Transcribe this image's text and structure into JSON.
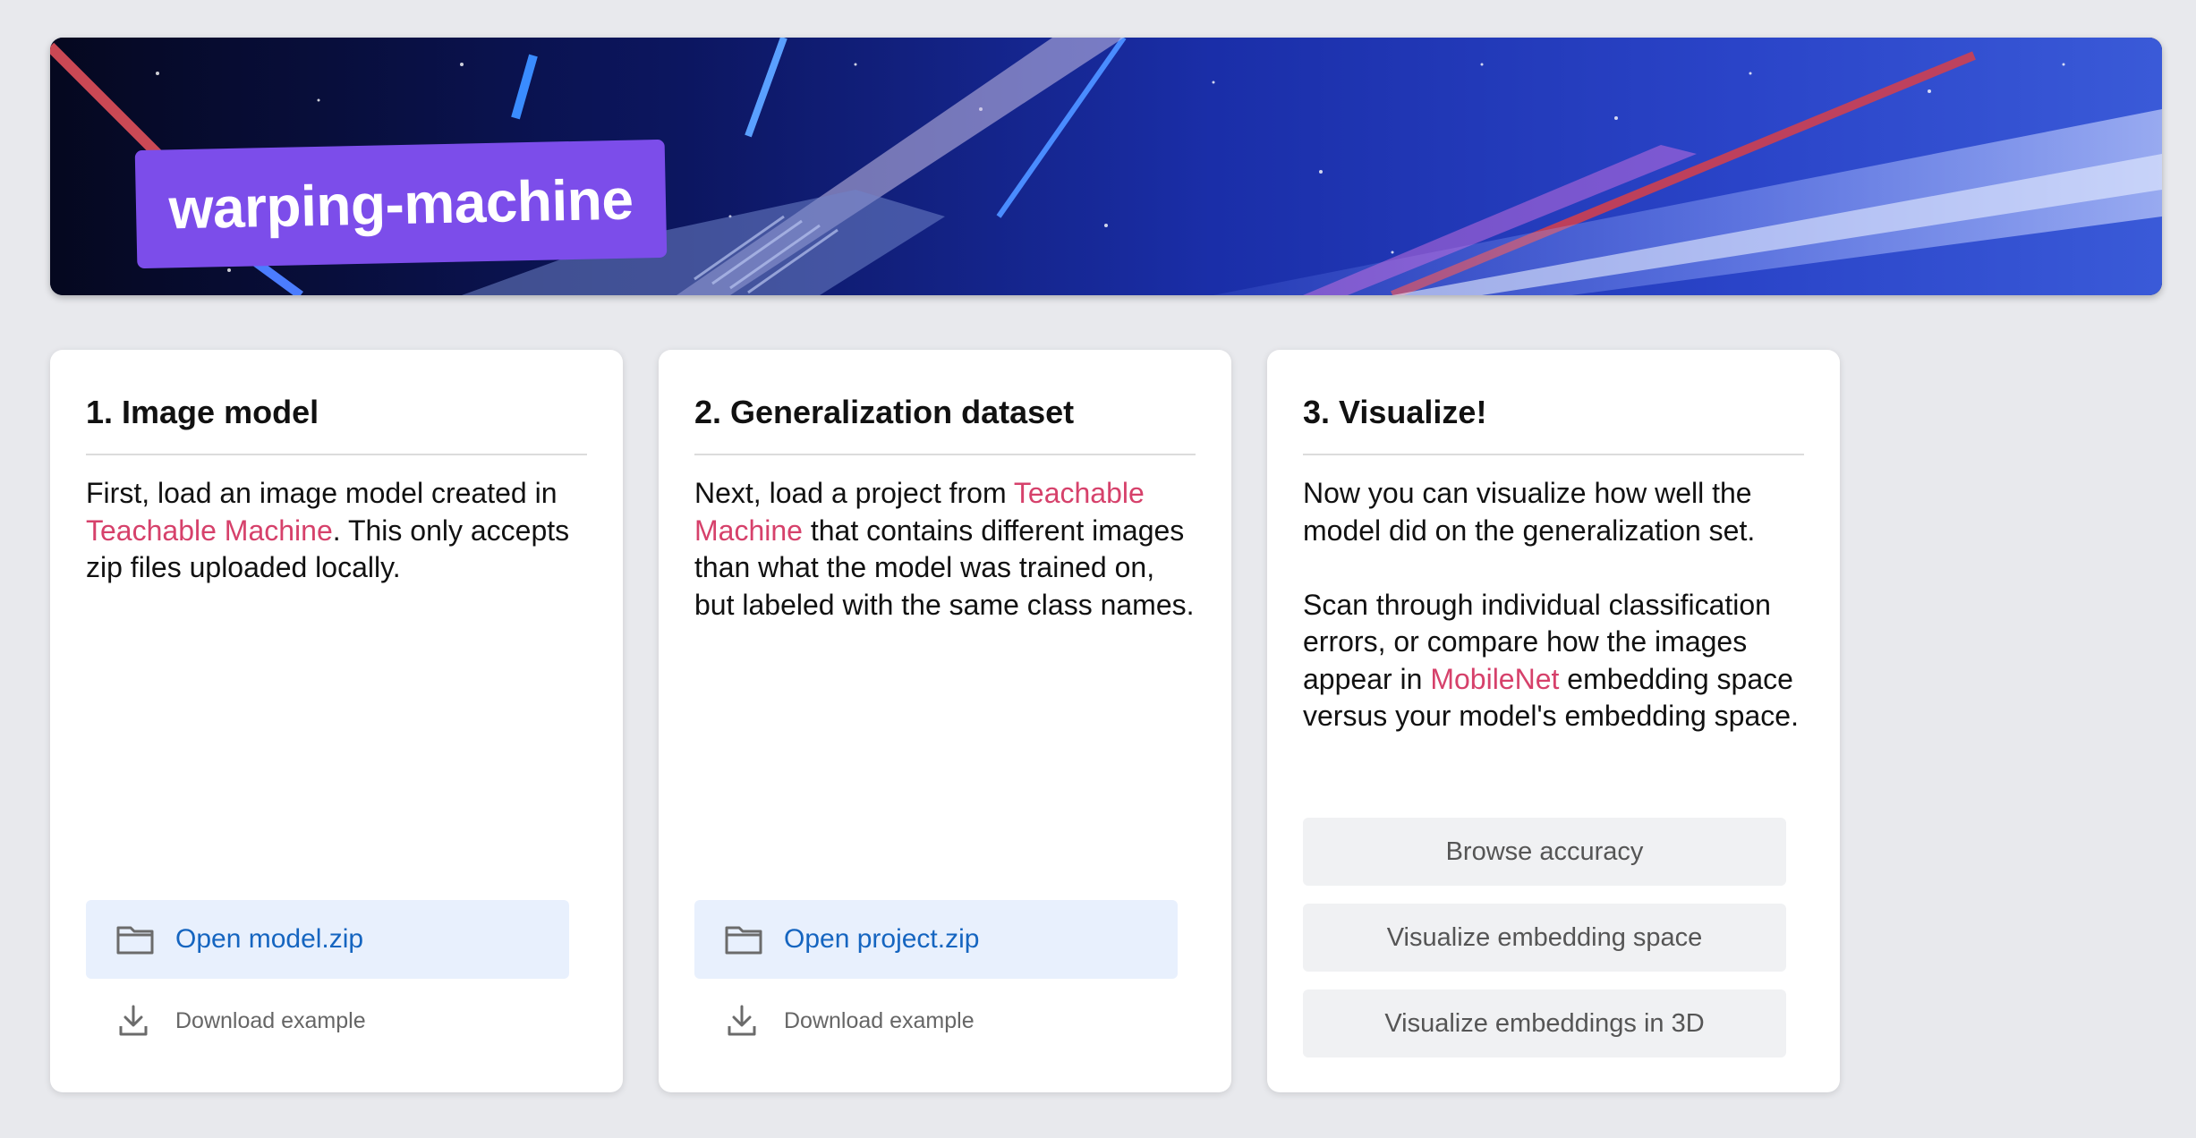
{
  "banner": {
    "title": "warping-machine"
  },
  "cards": [
    {
      "heading": "1. Image model",
      "text_1": "First, load an image model created in ",
      "link_1": "Teachable Machine",
      "text_2": ". This only accepts zip files uploaded locally.",
      "open_label": "Open model.zip",
      "download_label": "Download example"
    },
    {
      "heading": "2. Generalization dataset",
      "text_1": "Next, load a project from ",
      "link_1": "Teachable Machine",
      "text_2": " that contains different images than what the model was trained on, but labeled with the same class names.",
      "open_label": "Open project.zip",
      "download_label": "Download example"
    },
    {
      "heading": "3. Visualize!",
      "para_1": "Now you can visualize how well the model did on the generalization set.",
      "text_1": "Scan through individual classification errors, or compare how the images appear in ",
      "link_1": "MobileNet",
      "text_2": " embedding space versus your model's embedding space.",
      "buttons": [
        "Browse accuracy",
        "Visualize embedding space",
        "Visualize embeddings in 3D"
      ]
    }
  ],
  "colors": {
    "link": "#d6416b",
    "badge": "#7c4dea",
    "open_button_bg": "#e8f0fd",
    "open_button_text": "#1565c0",
    "page_bg": "#e8e9ed"
  },
  "icons": {
    "open": "folder-icon",
    "download": "download-icon"
  }
}
